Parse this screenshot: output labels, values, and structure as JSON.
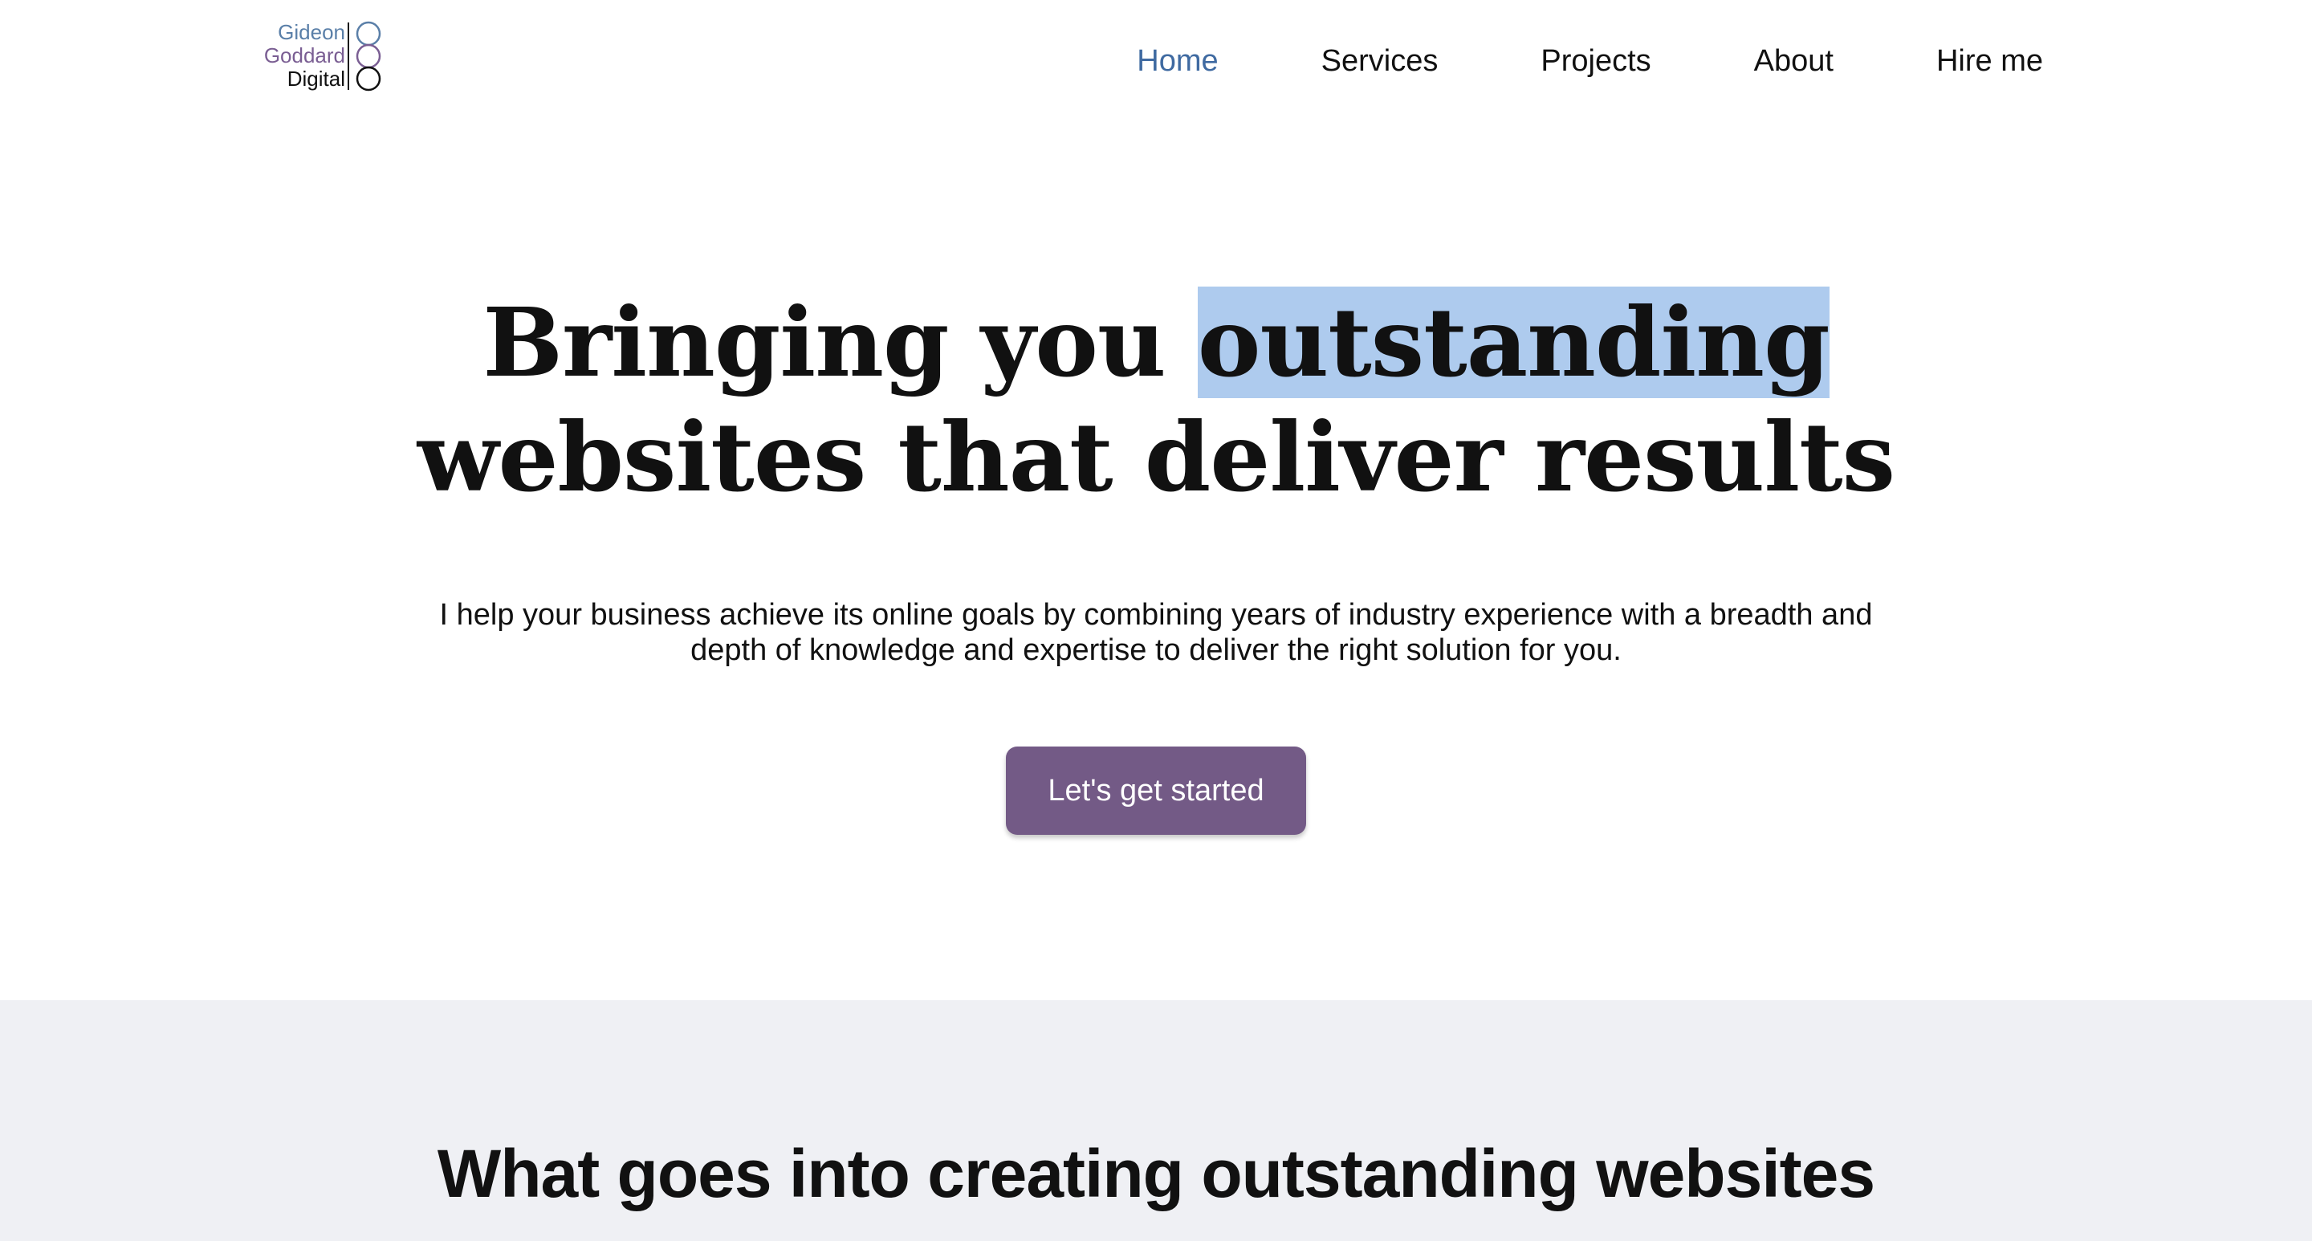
{
  "brand": {
    "logo_line1": "Gideon",
    "logo_line2": "Goddard",
    "logo_line3": "Digital",
    "colors": {
      "line1": "#5a7fa8",
      "line2": "#7a5e93",
      "line3": "#111111"
    }
  },
  "nav": {
    "items": [
      {
        "label": "Home",
        "active": true
      },
      {
        "label": "Services",
        "active": false
      },
      {
        "label": "Projects",
        "active": false
      },
      {
        "label": "About",
        "active": false
      },
      {
        "label": "Hire me",
        "active": false
      }
    ],
    "active_color": "#3f6aa1"
  },
  "hero": {
    "title_part1": "Bringing you ",
    "title_highlight": "outstanding",
    "title_part2": "websites that deliver results",
    "highlight_color": "#aecbee",
    "subtitle": "I help your business achieve its online goals by combining years of industry experience with a breadth and depth of knowledge and expertise to deliver the right solution for you.",
    "cta_label": "Let's get started",
    "cta_color": "#735a86"
  },
  "section2": {
    "title": "What goes into creating outstanding websites",
    "background": "#eff0f4"
  }
}
